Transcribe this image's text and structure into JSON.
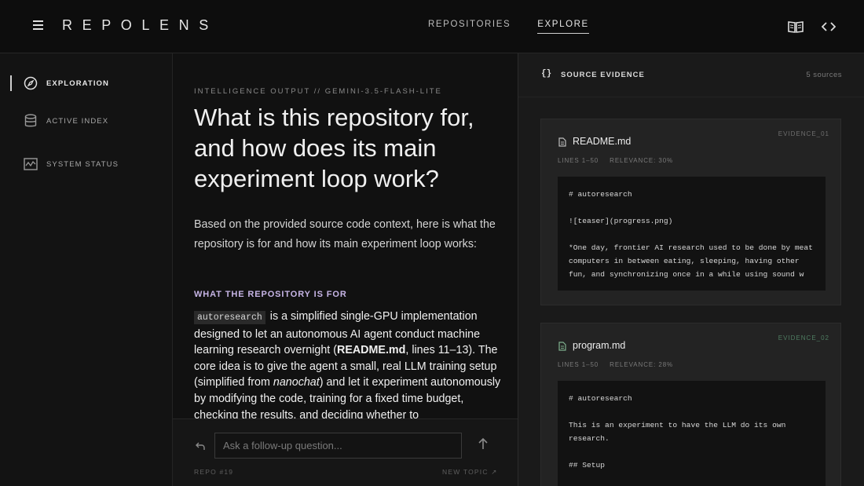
{
  "brand": "REPOLENS",
  "nav": {
    "repositories": "REPOSITORIES",
    "explore": "EXPLORE"
  },
  "top_icons": [
    "book-icon",
    "code-icon"
  ],
  "sidebar": {
    "items": [
      {
        "label": "EXPLORATION",
        "icon": "compass-icon"
      },
      {
        "label": "ACTIVE INDEX",
        "icon": "database-icon"
      },
      {
        "label": "SYSTEM STATUS",
        "icon": "activity-icon"
      }
    ]
  },
  "main": {
    "model_tag": "INTELLIGENCE OUTPUT // GEMINI-3.5-FLASH-LITE",
    "question": "What is this repository for, and how does its main experiment loop work?",
    "intro": "Based on the provided source code context, here is what the repository is for and how its main experiment loop works:",
    "section_heading": "WHAT THE REPOSITORY IS FOR",
    "body": {
      "code": "autoresearch",
      "t1": " is a simplified single-GPU implementation designed to let an autonomous AI agent conduct machine learning research overnight (",
      "bold": "README.md",
      "t2": ", lines 11–13). The core idea is to give the agent a small, real LLM training setup (simplified from ",
      "italic": "nanochat",
      "t3": ") and let it experiment autonomously by modifying the code, training for a fixed time budget, checking the results, and deciding whether to"
    }
  },
  "followup": {
    "placeholder": "Ask a follow-up question...",
    "repo_id": "REPO #19",
    "new_topic": "NEW TOPIC ↗"
  },
  "evidence": {
    "title": "SOURCE EVIDENCE",
    "count": "5 sources",
    "cards": [
      {
        "tag": "EVIDENCE_01",
        "file": "README.md",
        "lines": "LINES 1–50",
        "relevance": "RELEVANCE: 30%",
        "code": "# autoresearch\n\n![teaser](progress.png)\n\n*One day, frontier AI research used to be done by meat\ncomputers in between eating, sleeping, having other\nfun, and synchronizing once in a while using sound w"
      },
      {
        "tag": "EVIDENCE_02",
        "file": "program.md",
        "lines": "LINES 1–50",
        "relevance": "RELEVANCE: 28%",
        "code": "# autoresearch\n\nThis is an experiment to have the LLM do its own\nresearch.\n\n## Setup"
      }
    ]
  },
  "colors": {
    "accent_heading": "#c7b5e6",
    "evidence_highlight": "#4f7d62"
  }
}
